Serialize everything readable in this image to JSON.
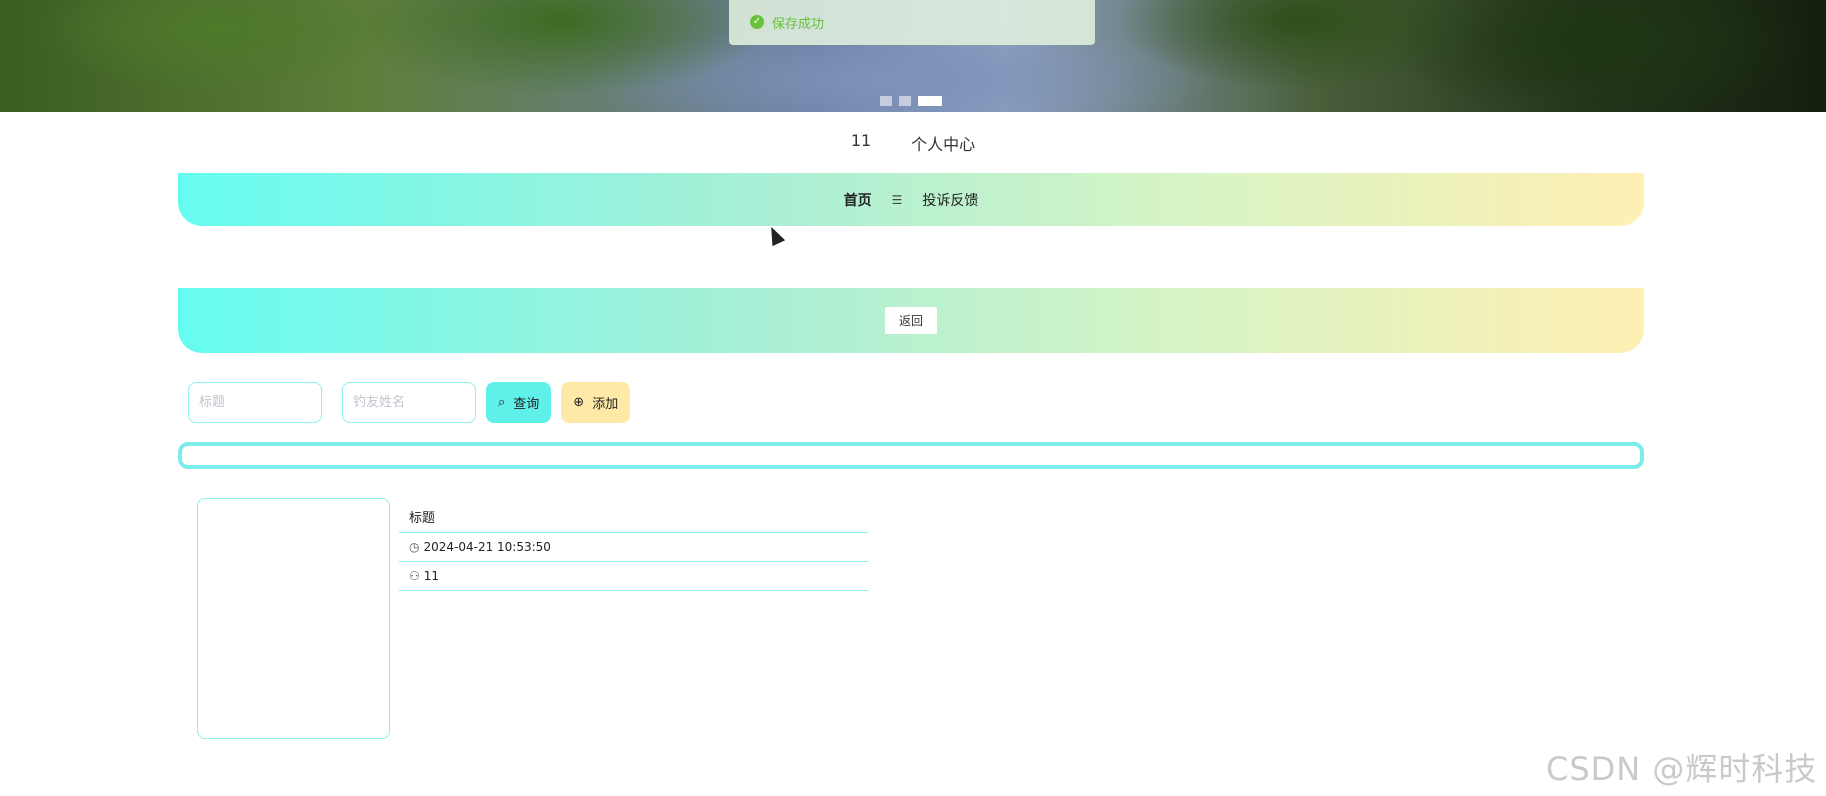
{
  "toast": {
    "message": "保存成功",
    "icon": "check-circle-icon"
  },
  "banner": {
    "slides": 3,
    "active_slide": 3
  },
  "user_bar": {
    "username": "11",
    "center_link": "个人中心"
  },
  "nav": {
    "home": "首页",
    "menu_icon": "☰",
    "complaint": "投诉反馈"
  },
  "sub_bar": {
    "back_label": "返回"
  },
  "search": {
    "title_placeholder": "标题",
    "name_placeholder": "钓友姓名",
    "query_label": "查询",
    "add_label": "添加"
  },
  "card": {
    "title": "标题",
    "date": "2024-04-21 10:53:50",
    "user": "11"
  },
  "watermark": "CSDN @辉时科技",
  "colors": {
    "accent": "#5ff0ea",
    "warm": "#ffe9a6",
    "success": "#67c23a"
  }
}
